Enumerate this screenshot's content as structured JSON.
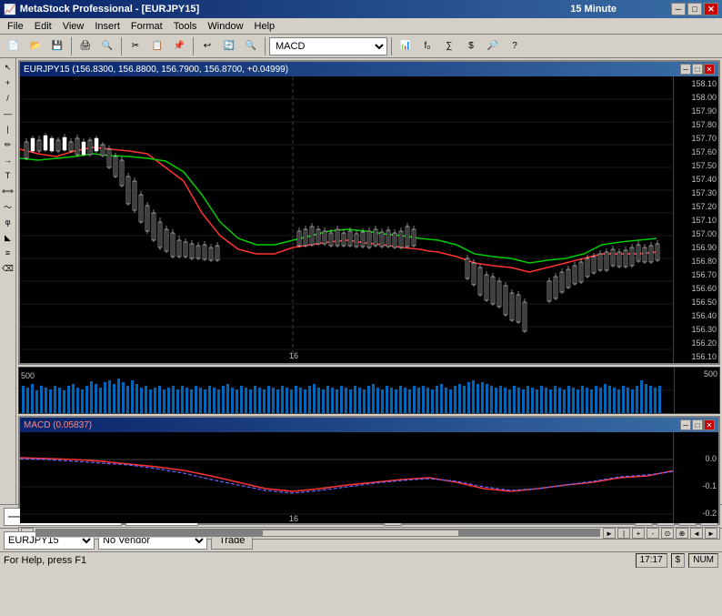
{
  "titlebar": {
    "title": "MetaStock Professional - [EURJPY15]",
    "timeframe": "15 Minute",
    "min_btn": "─",
    "max_btn": "□",
    "close_btn": "✕"
  },
  "menubar": {
    "items": [
      "File",
      "Edit",
      "View",
      "Insert",
      "Format",
      "Tools",
      "Window",
      "Help"
    ]
  },
  "toolbar": {
    "indicator_label": "MACD"
  },
  "price_chart": {
    "title": "EURJPY15 (156.8300, 156.8800, 156.7900, 156.8700, +0.04999)",
    "y_labels": [
      "158.10",
      "158.00",
      "157.90",
      "157.80",
      "157.70",
      "157.60",
      "157.50",
      "157.40",
      "157.30",
      "157.20",
      "157.10",
      "157.00",
      "156.90",
      "156.80",
      "156.70",
      "156.60",
      "156.50",
      "156.40",
      "156.30",
      "156.20",
      "156.10"
    ],
    "y_positions": [
      5,
      20,
      35,
      50,
      65,
      80,
      95,
      110,
      125,
      140,
      155,
      170,
      185,
      200,
      215,
      230,
      245,
      260,
      275,
      290,
      305
    ]
  },
  "volume_chart": {
    "y_label": "500"
  },
  "macd_chart": {
    "title": "MACD (0.05837)",
    "y_labels": [
      "0.0",
      "-0.1",
      "-0.2"
    ],
    "y_positions": [
      10,
      60,
      110
    ]
  },
  "bottom_bar": {
    "symbol": "EURJPY15",
    "vendor": "No Vendor",
    "trade_btn": "Trade"
  },
  "status_bar": {
    "help_text": "For Help, press F1",
    "time": "17:17",
    "currency": "$",
    "keyboard": "NUM"
  },
  "colors": {
    "up_candle": "#ffffff",
    "down_candle": "#000000",
    "ma_red": "#ff0000",
    "ma_green": "#00cc00",
    "volume_blue": "#0066cc",
    "macd_red": "#ff4040",
    "macd_blue": "#6666ff",
    "background": "#000000"
  }
}
